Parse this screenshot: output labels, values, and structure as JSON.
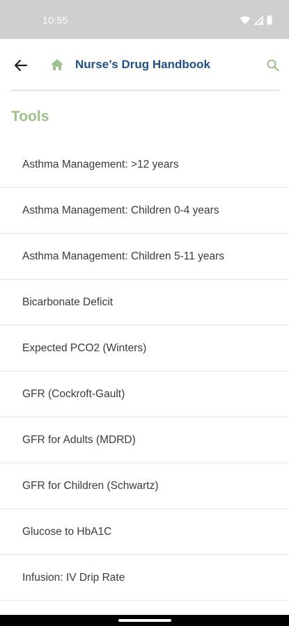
{
  "status_bar": {
    "time": "10:55",
    "icons": [
      "wifi-icon",
      "signal-icon",
      "battery-icon"
    ]
  },
  "app_bar": {
    "back_icon": "arrow-left-icon",
    "home_icon": "home-icon",
    "title": "Nurse’s Drug Handbook",
    "search_icon": "search-icon",
    "title_color": "#1f4f8c",
    "accent_color": "#9cc28a"
  },
  "section": {
    "title": "Tools"
  },
  "tools": [
    {
      "label": "Asthma Management: >12 years"
    },
    {
      "label": "Asthma Management: Children 0-4 years"
    },
    {
      "label": "Asthma Management: Children 5-11 years"
    },
    {
      "label": "Bicarbonate Deficit"
    },
    {
      "label": "Expected PCO2 (Winters)"
    },
    {
      "label": "GFR (Cockroft-Gault)"
    },
    {
      "label": "GFR for Adults (MDRD)"
    },
    {
      "label": "GFR for Children (Schwartz)"
    },
    {
      "label": "Glucose to HbA1C"
    },
    {
      "label": "Infusion: IV Drip Rate"
    }
  ]
}
